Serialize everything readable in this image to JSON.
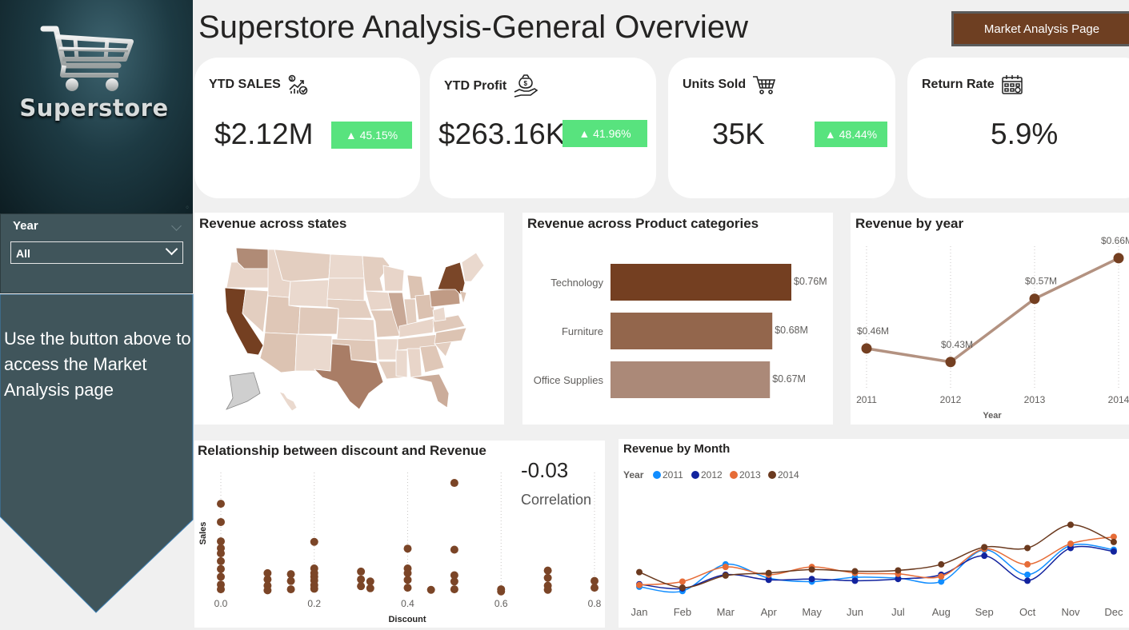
{
  "logo": {
    "brand": "Superstore"
  },
  "slicer": {
    "title": "Year",
    "selected": "All"
  },
  "note": "Use the button above to access the Market Analysis page",
  "header": {
    "title": "Superstore Analysis-General Overview",
    "button": "Market Analysis Page"
  },
  "kpis": [
    {
      "label": "YTD SALES",
      "value": "$2.12M",
      "badge": "▲ 45.15%",
      "icon": "sales-chart-icon"
    },
    {
      "label": "YTD Profit",
      "value": "$263.16K",
      "badge": "▲ 41.96%",
      "icon": "money-hand-icon"
    },
    {
      "label": "Units Sold",
      "value": "35K",
      "badge": "▲ 48.44%",
      "icon": "cart-icon"
    },
    {
      "label": "Return Rate",
      "value": "5.9%",
      "icon": "calendar-icon"
    }
  ],
  "colors": {
    "accent": "#6e3f22",
    "badge": "#58e37e",
    "panel": "#40555b"
  },
  "tiles": {
    "map": {
      "title": "Revenue across states"
    },
    "categories": {
      "title": "Revenue across Product categories"
    },
    "year": {
      "title": "Revenue by year"
    },
    "discount": {
      "title": "Relationship between discount and Revenue"
    },
    "month": {
      "title": "Revenue by Month"
    }
  },
  "correlation": {
    "value": "-0.03",
    "label": "Correlation"
  },
  "chart_data": [
    {
      "id": "categories",
      "type": "bar",
      "orientation": "horizontal",
      "title": "Revenue across Product categories",
      "categories": [
        "Technology",
        "Furniture",
        "Office Supplies"
      ],
      "values": [
        0.76,
        0.68,
        0.67
      ],
      "labels": [
        "$0.76M",
        "$0.68M",
        "$0.67M"
      ],
      "colors": [
        "#743f21",
        "#93664c",
        "#ab8978"
      ],
      "xlim": [
        0,
        0.76
      ]
    },
    {
      "id": "year",
      "type": "line",
      "title": "Revenue by year",
      "xlabel": "Year",
      "x": [
        "2011",
        "2012",
        "2013",
        "2014"
      ],
      "values": [
        0.46,
        0.43,
        0.57,
        0.66
      ],
      "labels": [
        "$0.46M",
        "$0.43M",
        "$0.57M",
        "$0.66M"
      ],
      "ylim": [
        0.38,
        0.69
      ],
      "colors": {
        "line": "#b39281",
        "marker": "#743f21"
      }
    },
    {
      "id": "discount",
      "type": "scatter",
      "title": "Relationship between discount and Revenue",
      "xlabel": "Discount",
      "ylabel": "Sales",
      "xlim": [
        0,
        0.8
      ],
      "ylim": [
        0,
        23000
      ],
      "xticks": [
        "0.0",
        "0.2",
        "0.4",
        "0.6",
        "0.8"
      ],
      "color": "#7b4527",
      "points": [
        [
          0.0,
          17000
        ],
        [
          0.0,
          13500
        ],
        [
          0.0,
          9800
        ],
        [
          0.0,
          8500
        ],
        [
          0.0,
          7500
        ],
        [
          0.0,
          6000
        ],
        [
          0.0,
          4500
        ],
        [
          0.0,
          3000
        ],
        [
          0.0,
          1500
        ],
        [
          0.0,
          600
        ],
        [
          0.1,
          3700
        ],
        [
          0.1,
          2500
        ],
        [
          0.1,
          1300
        ],
        [
          0.1,
          400
        ],
        [
          0.15,
          3500
        ],
        [
          0.15,
          2200
        ],
        [
          0.15,
          600
        ],
        [
          0.2,
          9700
        ],
        [
          0.2,
          4600
        ],
        [
          0.2,
          3700
        ],
        [
          0.2,
          3000
        ],
        [
          0.2,
          2300
        ],
        [
          0.2,
          1400
        ],
        [
          0.2,
          700
        ],
        [
          0.3,
          4000
        ],
        [
          0.3,
          2500
        ],
        [
          0.3,
          1200
        ],
        [
          0.32,
          2100
        ],
        [
          0.32,
          800
        ],
        [
          0.4,
          8400
        ],
        [
          0.4,
          4600
        ],
        [
          0.4,
          3700
        ],
        [
          0.4,
          2400
        ],
        [
          0.4,
          900
        ],
        [
          0.45,
          500
        ],
        [
          0.5,
          21000
        ],
        [
          0.5,
          8200
        ],
        [
          0.5,
          3300
        ],
        [
          0.5,
          2100
        ],
        [
          0.5,
          600
        ],
        [
          0.6,
          600
        ],
        [
          0.6,
          200
        ],
        [
          0.7,
          4200
        ],
        [
          0.7,
          2800
        ],
        [
          0.7,
          1300
        ],
        [
          0.7,
          500
        ],
        [
          0.8,
          2200
        ],
        [
          0.8,
          900
        ]
      ]
    },
    {
      "id": "month",
      "type": "line",
      "title": "Revenue by Month",
      "legend_title": "Year",
      "legend_position": "top-left",
      "categories": [
        "Jan",
        "Feb",
        "Mar",
        "Apr",
        "May",
        "Jun",
        "Jul",
        "Aug",
        "Sep",
        "Oct",
        "Nov",
        "Dec"
      ],
      "ylim": [
        0,
        130
      ],
      "series": [
        {
          "name": "2011",
          "color": "#118dff",
          "values": [
            14,
            9,
            40,
            24,
            20,
            25,
            24,
            20,
            57,
            28,
            62,
            57
          ]
        },
        {
          "name": "2012",
          "color": "#12239e",
          "values": [
            17,
            12,
            28,
            22,
            23,
            21,
            23,
            28,
            50,
            21,
            59,
            55
          ]
        },
        {
          "name": "2013",
          "color": "#e66c37",
          "values": [
            16,
            20,
            37,
            28,
            37,
            30,
            29,
            26,
            58,
            40,
            64,
            72
          ]
        },
        {
          "name": "2014",
          "color": "#6b3a1f",
          "values": [
            31,
            13,
            27,
            30,
            34,
            32,
            33,
            40,
            60,
            59,
            86,
            66
          ]
        }
      ]
    }
  ]
}
